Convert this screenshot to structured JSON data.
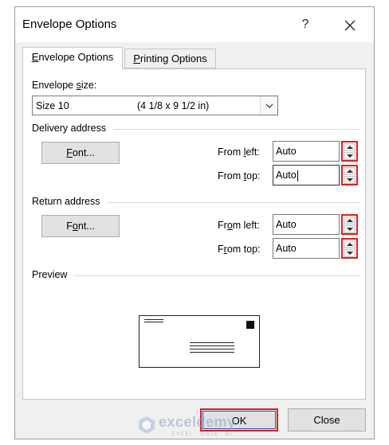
{
  "window": {
    "title": "Envelope Options",
    "help_label": "?",
    "close_icon": "close-icon"
  },
  "tabs": [
    {
      "label_pre": "",
      "label_u": "E",
      "label_post": "nvelope Options",
      "active": true
    },
    {
      "label_pre": "",
      "label_u": "P",
      "label_post": "rinting Options",
      "active": false
    }
  ],
  "envelope_size": {
    "label_pre": "Envelope ",
    "label_u": "s",
    "label_post": "ize:",
    "selected": "Size 10",
    "dimensions": "(4 1/8 x 9 1/2 in)"
  },
  "delivery_address": {
    "heading": "Delivery address",
    "font_button": {
      "pre": "",
      "u": "F",
      "post": "ont..."
    },
    "from_left": {
      "label_pre": "From ",
      "label_u": "l",
      "label_post": "eft:",
      "value": "Auto"
    },
    "from_top": {
      "label_pre": "From ",
      "label_u": "t",
      "label_post": "op:",
      "value": "Auto"
    }
  },
  "return_address": {
    "heading": "Return address",
    "font_button": {
      "pre": "F",
      "u": "o",
      "post": "nt..."
    },
    "from_left": {
      "label_pre": "Fr",
      "label_u": "o",
      "label_post": "m left:",
      "value": "Auto"
    },
    "from_top": {
      "label_pre": "F",
      "label_u": "r",
      "label_post": "om top:",
      "value": "Auto"
    }
  },
  "preview": {
    "heading": "Preview"
  },
  "footer": {
    "ok_label": "OK",
    "close_label": "Close"
  },
  "watermark": {
    "brand": "exceldemy",
    "tagline": "EXCEL · DATA · BI"
  },
  "colors": {
    "highlight": "#d92121",
    "focus": "#1e5bd4",
    "dialog_bg": "#f0f0f0"
  }
}
